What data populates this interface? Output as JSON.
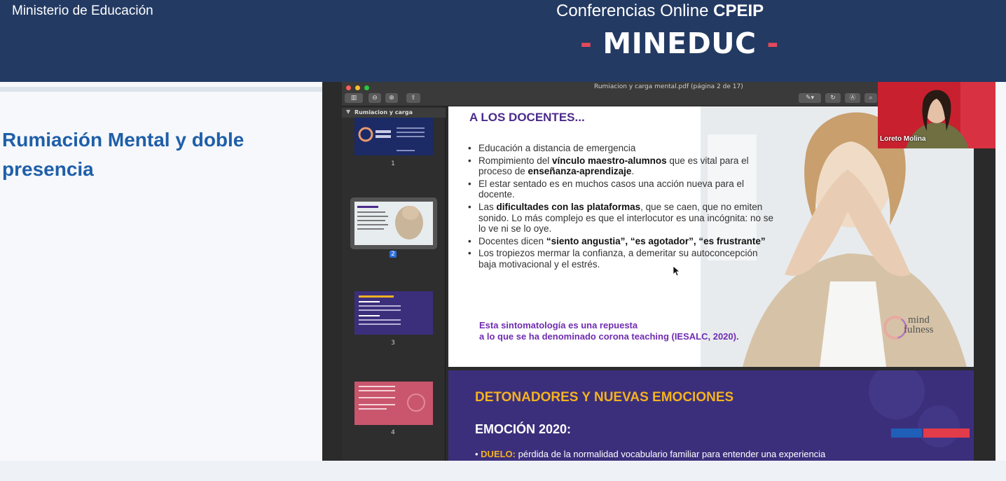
{
  "header": {
    "ministry": "Ministerio de Educación",
    "conf_prefix": "Conferencias Online",
    "conf_bold": "CPEIP",
    "dash_left": "-",
    "brand": "MINEDUC",
    "dash_right": "-"
  },
  "topic_title": "Rumiación Mental y doble presencia",
  "viewer": {
    "doc_title": "Rumiacion y carga mental.pdf (página 2 de 17)",
    "sidebar_title": "Rumiacion y carga mental.pdf",
    "thumbs": [
      {
        "num": "1",
        "color": "#1c2a66"
      },
      {
        "num": "2",
        "color": "#e7ecef"
      },
      {
        "num": "3",
        "color": "#3b2f7c"
      },
      {
        "num": "4",
        "color": "#c9566d"
      }
    ]
  },
  "slide": {
    "heading": "A LOS DOCENTES...",
    "bullets": [
      {
        "plain": "Educación a distancia de emergencia"
      },
      {
        "plain": "Rompimiento del ",
        "bold": "vínculo maestro-alumnos",
        "plain2": " que es vital para el proceso de ",
        "bold2": "enseñanza-aprendizaje",
        "plain3": "."
      },
      {
        "plain": "El estar sentado es en muchos casos una acción nueva para el docente."
      },
      {
        "plain": "Las ",
        "bold": "dificultades con las plataformas",
        "plain2": ", que se caen, que no emiten sonido. Lo más complejo es que el interlocutor es una incógnita: no se lo ve ni se lo oye."
      },
      {
        "plain": "Docentes dicen ",
        "bold": "“siento angustia”, “es agotador”, “es frustrante”"
      },
      {
        "plain": "Los tropiezos mermar la confianza, a demeritar su autoconcepción baja motivacional y el estrés."
      }
    ],
    "note_line1": "Esta sintomatología es una repuesta",
    "note_line2": "a lo que se ha denominado corona teaching (IESALC, 2020).",
    "logo_word1": "mind",
    "logo_word2": "fulness"
  },
  "next_slide": {
    "heading": "DETONADORES Y NUEVAS EMOCIONES",
    "sub": "EMOCIÓN 2020:",
    "line_bold": "DUELO:",
    "line_rest": " pérdida de la normalidad vocabulario familiar para entender una experiencia"
  },
  "camera": {
    "name": "Loreto Molina"
  },
  "colors": {
    "header_bg": "#233a63",
    "accent_red": "#e24a5a",
    "title_blue": "#1f5fa8",
    "slide_purple": "#4b2a8c",
    "next_bg": "#3b2f7c",
    "next_yellow": "#f5b21f"
  }
}
